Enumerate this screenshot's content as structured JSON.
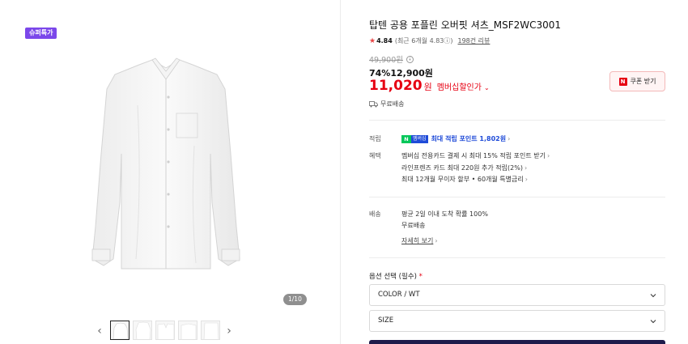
{
  "gallery": {
    "badge": "슈퍼특가",
    "counter": "1/10",
    "thumb_count": 5
  },
  "product": {
    "title": "탑텐 공용 포플린 오버핏 셔츠_MSF2WC3001",
    "rating": "4.84",
    "rating_sub": "(최근 6개월 4.83ⓘ)",
    "reviews": "198건 리뷰",
    "original_price": "49,900원",
    "discount": "74%",
    "sale_price": "12,900원",
    "member_price": "11,020",
    "member_unit": "원",
    "member_label": "멤버십할인가",
    "coupon_label": "쿠폰 받기",
    "shipping": "무료배송"
  },
  "benefits": {
    "point_label": "적립",
    "npay_n": "N",
    "npay_m": "멤버십",
    "point_text": "최대 적립 포인트 1,802원",
    "benefit_label": "혜택",
    "benefit_lines": [
      "멤버십 전용카드 결제 시 최대 15% 적립 포인트 받기",
      "라인프렌즈 카드 최대 220원 추가 적립(2%)",
      "최대 12개월 무이자 할부 • 60개월 특별금리"
    ]
  },
  "delivery": {
    "label": "배송",
    "line1": "평균 2일 이내 도착 확률 100%",
    "line2": "무료배송",
    "detail": "자세히 보기"
  },
  "options": {
    "title": "옵션 선택 (필수)",
    "required_mark": "*",
    "color": "COLOR / WT",
    "size": "SIZE"
  },
  "colors": {
    "accent_red": "#e60012",
    "badge_purple": "#7b47ea",
    "npay_green": "#03c75a"
  }
}
